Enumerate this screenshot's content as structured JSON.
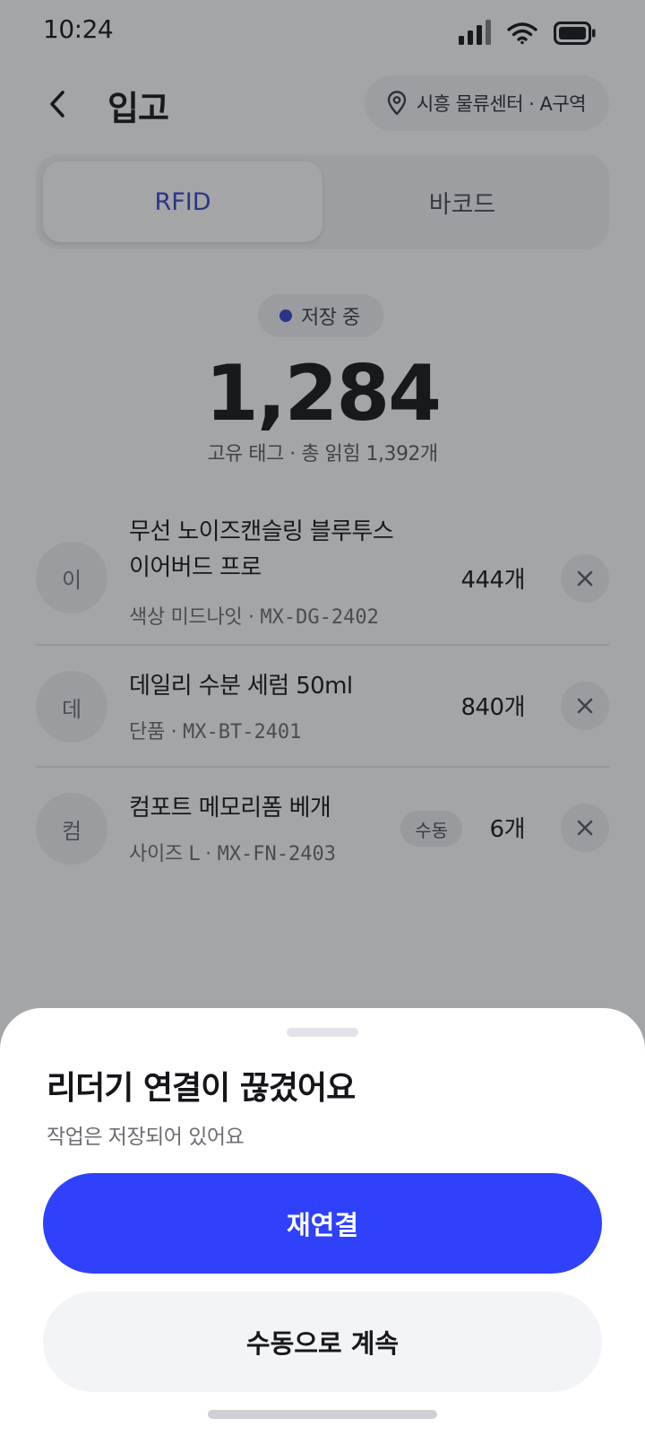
{
  "status_bar": {
    "time": "10:24"
  },
  "header": {
    "title": "입고",
    "location": "시흥 물류센터 · A구역"
  },
  "tabs": [
    {
      "label": "RFID",
      "active": true
    },
    {
      "label": "바코드",
      "active": false
    }
  ],
  "summary": {
    "status": "저장 중",
    "count": "1,284",
    "subtitle": "고유 태그 · 총 읽힘 1,392개"
  },
  "items": [
    {
      "avatar": "이",
      "name_line1": "무선 노이즈캔슬링 블루투스",
      "name_line2": "이어버드 프로",
      "meta_prefix": "색상 미드나잇 · ",
      "code": "MX-DG-2402",
      "qty": "444개"
    },
    {
      "avatar": "데",
      "name_line1": "데일리 수분 세럼 50ml",
      "meta_prefix": "단품 · ",
      "code": "MX-BT-2401",
      "qty": "840개"
    },
    {
      "avatar": "컴",
      "name_line1": "컴포트 메모리폼 베개",
      "meta_prefix": "사이즈 L · ",
      "code": "MX-FN-2403",
      "badge": "수동",
      "qty": "6개"
    }
  ],
  "sheet": {
    "title": "리더기 연결이 끊겼어요",
    "subtitle": "작업은 저장되어 있어요",
    "primary_label": "재연결",
    "secondary_label": "수동으로 계속"
  },
  "colors": {
    "accent": "#2f41fa",
    "tab_active_text": "#3545c8",
    "overlay": "rgba(28,30,36,0.40)"
  },
  "icons": {
    "back": "chevron-left-icon",
    "location": "map-pin-icon",
    "remove": "close-icon",
    "signal": "cellular-signal-icon",
    "wifi": "wifi-icon",
    "battery": "battery-icon"
  }
}
